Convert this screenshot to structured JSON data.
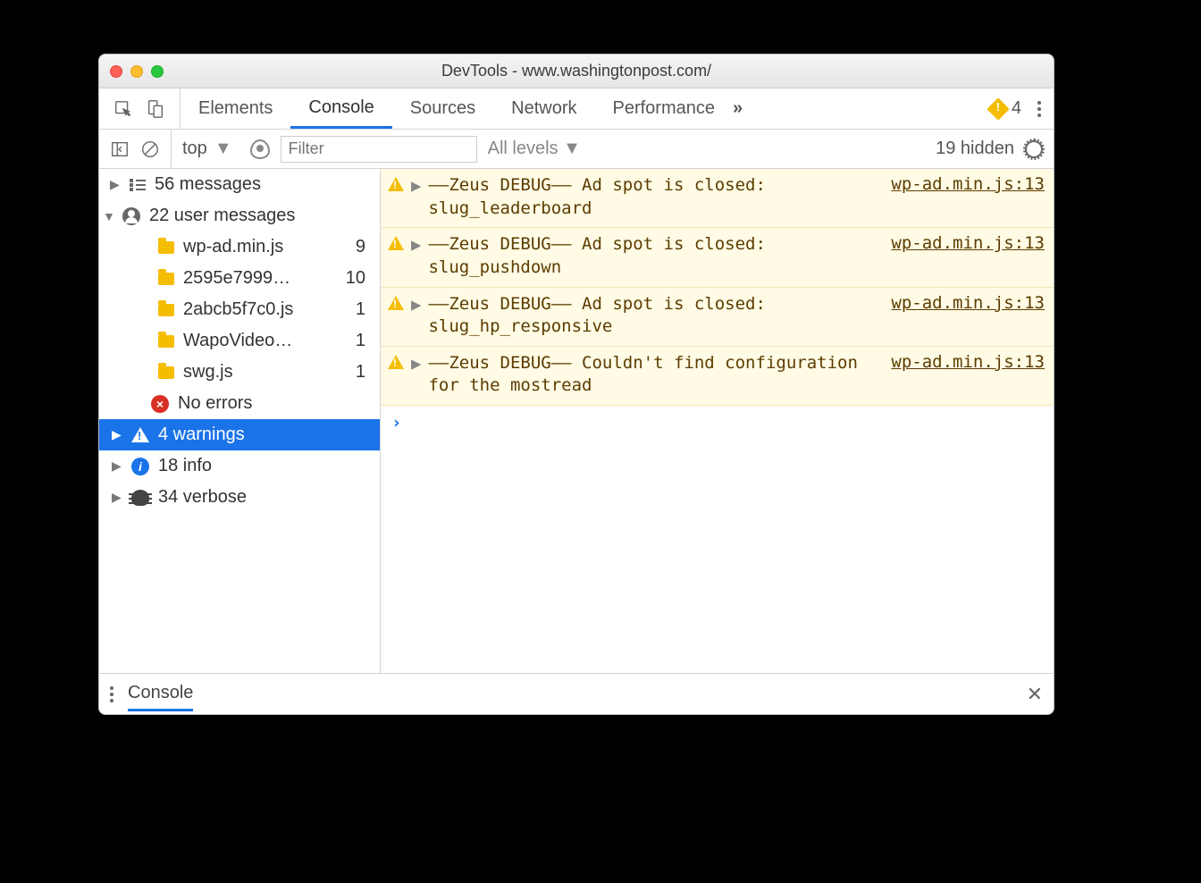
{
  "window": {
    "title": "DevTools - www.washingtonpost.com/"
  },
  "tabs": {
    "items": [
      "Elements",
      "Console",
      "Sources",
      "Network",
      "Performance"
    ],
    "active_index": 1,
    "warning_count": "4"
  },
  "filterbar": {
    "context": "top",
    "filter_placeholder": "Filter",
    "levels_label": "All levels",
    "hidden_label": "19 hidden"
  },
  "sidebar": {
    "messages": {
      "label": "56 messages"
    },
    "user_messages": {
      "label": "22 user messages",
      "files": [
        {
          "name": "wp-ad.min.js",
          "count": "9"
        },
        {
          "name": "2595e7999…",
          "count": "10"
        },
        {
          "name": "2abcb5f7c0.js",
          "count": "1"
        },
        {
          "name": "WapoVideo…",
          "count": "1"
        },
        {
          "name": "swg.js",
          "count": "1"
        }
      ]
    },
    "errors": {
      "label": "No errors"
    },
    "warnings": {
      "label": "4 warnings"
    },
    "info": {
      "label": "18 info"
    },
    "verbose": {
      "label": "34 verbose"
    }
  },
  "console": {
    "messages": [
      {
        "text": "––Zeus DEBUG–– Ad spot is closed: slug_leaderboard",
        "source": "wp-ad.min.js:13"
      },
      {
        "text": "––Zeus DEBUG–– Ad spot is closed: slug_pushdown",
        "source": "wp-ad.min.js:13"
      },
      {
        "text": "––Zeus DEBUG–– Ad spot is closed: slug_hp_responsive",
        "source": "wp-ad.min.js:13"
      },
      {
        "text": "––Zeus DEBUG–– Couldn't find configuration for the mostread",
        "source": "wp-ad.min.js:13"
      }
    ],
    "prompt": "›"
  },
  "drawer": {
    "label": "Console"
  }
}
